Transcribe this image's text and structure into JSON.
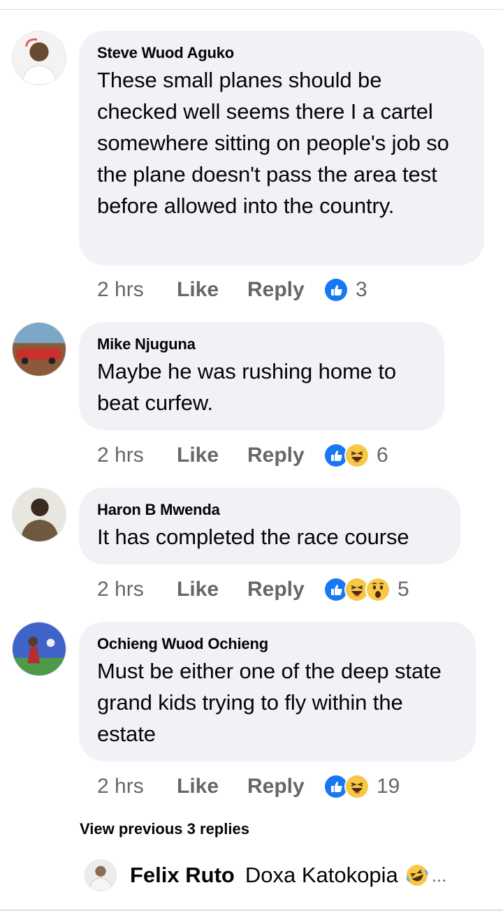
{
  "comments": [
    {
      "author": "Steve Wuod Aguko",
      "text": "These small planes should be checked well seems there I a cartel somewhere sitting on people's job so the plane doesn't pass the area test before allowed into the country.",
      "time": "2 hrs",
      "like_label": "Like",
      "reply_label": "Reply",
      "reactions": [
        "like-icon"
      ],
      "reaction_count": "3"
    },
    {
      "author": "Mike Njuguna",
      "text": "Maybe he was rushing home to beat curfew.",
      "time": "2 hrs",
      "like_label": "Like",
      "reply_label": "Reply",
      "reactions": [
        "like-icon",
        "haha-icon"
      ],
      "reaction_count": "6"
    },
    {
      "author": "Haron B Mwenda",
      "text": "It has completed the race course",
      "time": "2 hrs",
      "like_label": "Like",
      "reply_label": "Reply",
      "reactions": [
        "like-icon",
        "haha-icon",
        "wow-icon"
      ],
      "reaction_count": "5"
    },
    {
      "author": "Ochieng Wuod Ochieng",
      "text": "Must be either one of the deep state grand kids trying to fly within the estate",
      "time": "2 hrs",
      "like_label": "Like",
      "reply_label": "Reply",
      "reactions": [
        "like-icon",
        "haha-icon"
      ],
      "reaction_count": "19"
    }
  ],
  "view_previous_label": "View previous 3 replies",
  "reply_preview": {
    "author": "Felix Ruto",
    "text": "Doxa Katokopia",
    "emoji": "rolling-laughing-icon",
    "ellipsis": "..."
  },
  "colors": {
    "bubble": "#f0f2f5",
    "meta_text": "#65676b",
    "like_blue": "#1877f2",
    "haha_yellow": "#f7c845"
  }
}
